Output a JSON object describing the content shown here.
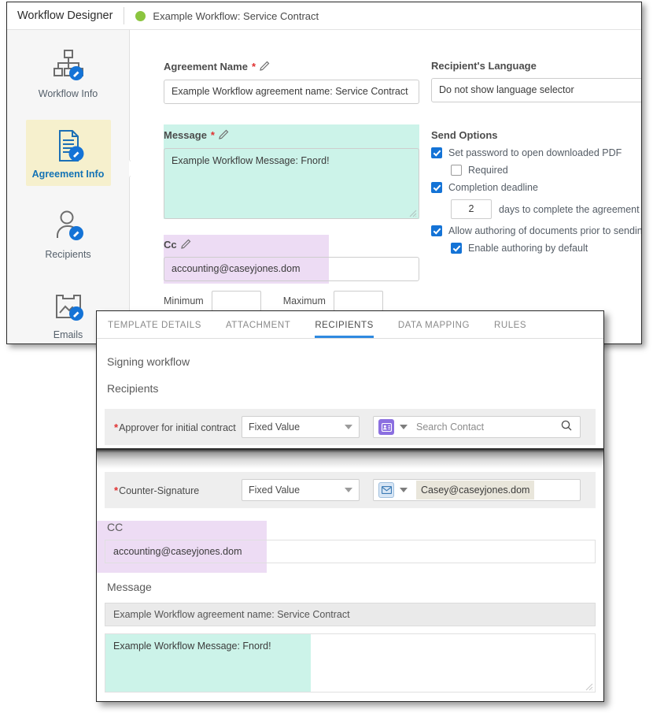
{
  "app": {
    "title": "Workflow Designer",
    "workflow_name": "Example Workflow: Service Contract",
    "status_dot_color": "#8bc53f"
  },
  "sidebar": {
    "items": [
      {
        "label": "Workflow Info",
        "icon": "org-chart-edit-icon",
        "active": false
      },
      {
        "label": "Agreement Info",
        "icon": "document-edit-icon",
        "active": true
      },
      {
        "label": "Recipients",
        "icon": "person-edit-icon",
        "active": false
      },
      {
        "label": "Emails",
        "icon": "image-mail-edit-icon",
        "active": false
      }
    ]
  },
  "form": {
    "agreement_name": {
      "label": "Agreement Name",
      "required_mark": "*",
      "value": "Example Workflow agreement name: Service Contract"
    },
    "message": {
      "label": "Message",
      "required_mark": "*",
      "value": "Example Workflow Message: Fnord!"
    },
    "cc": {
      "label": "Cc",
      "value": "accounting@caseyjones.dom",
      "minimum_label": "Minimum",
      "minimum_value": "",
      "maximum_label": "Maximum",
      "maximum_value": ""
    },
    "recipient_language": {
      "label": "Recipient's Language",
      "value": "Do not show language selector"
    },
    "send_options": {
      "heading": "Send Options",
      "options": [
        {
          "label": "Set password to open downloaded PDF",
          "checked": true,
          "indent": false
        },
        {
          "label": "Required",
          "checked": false,
          "indent": true
        },
        {
          "label": "Completion deadline",
          "checked": true,
          "indent": false
        },
        {
          "label": "Allow authoring of documents prior to sending",
          "checked": true,
          "indent": false
        },
        {
          "label": "Enable authoring by default",
          "checked": true,
          "indent": true
        }
      ],
      "days_value": "2",
      "days_text": "days to complete the agreement"
    }
  },
  "overlay": {
    "tabs": [
      {
        "label": "TEMPLATE DETAILS",
        "active": false
      },
      {
        "label": "ATTACHMENT",
        "active": false
      },
      {
        "label": "RECIPIENTS",
        "active": true
      },
      {
        "label": "DATA MAPPING",
        "active": false
      },
      {
        "label": "RULES",
        "active": false
      }
    ],
    "active_tab_color": "#2f8ae0",
    "signing_workflow_heading": "Signing workflow",
    "recipients_heading": "Recipients",
    "recipient_rows": [
      {
        "required_mark": "*",
        "label": "Approver for initial contract",
        "select_value": "Fixed Value",
        "icon": "contact-card-icon",
        "icon_color": "#8b6fe0",
        "contact_value": "",
        "contact_placeholder": "Search Contact",
        "has_search_icon": true
      },
      {
        "required_mark": "*",
        "label": "Counter-Signature",
        "select_value": "Fixed Value",
        "icon": "envelope-icon",
        "icon_color": "#d8e6f5",
        "contact_value": "Casey@caseyjones.dom",
        "contact_placeholder": "",
        "has_search_icon": false
      }
    ],
    "cc_label": "CC",
    "cc_value": "accounting@caseyjones.dom",
    "message_label": "Message",
    "message_subject_value": "Example Workflow agreement name: Service Contract",
    "message_body_value": "Example Workflow Message: Fnord!"
  },
  "highlights": {
    "mint": "#ccf3e9",
    "purple": "#eddcf4"
  }
}
